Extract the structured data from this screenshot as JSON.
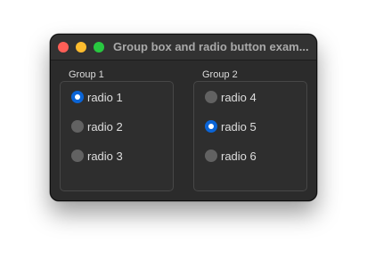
{
  "window": {
    "title": "Group box and radio button exam..."
  },
  "groups": [
    {
      "label": "Group 1",
      "options": [
        {
          "label": "radio 1",
          "checked": true
        },
        {
          "label": "radio 2",
          "checked": false
        },
        {
          "label": "radio 3",
          "checked": false
        }
      ]
    },
    {
      "label": "Group 2",
      "options": [
        {
          "label": "radio 4",
          "checked": false
        },
        {
          "label": "radio 5",
          "checked": true
        },
        {
          "label": "radio 6",
          "checked": false
        }
      ]
    }
  ],
  "colors": {
    "accent": "#0a64d6",
    "close": "#ff5f57",
    "minimize": "#febc2e",
    "maximize": "#28c840"
  }
}
